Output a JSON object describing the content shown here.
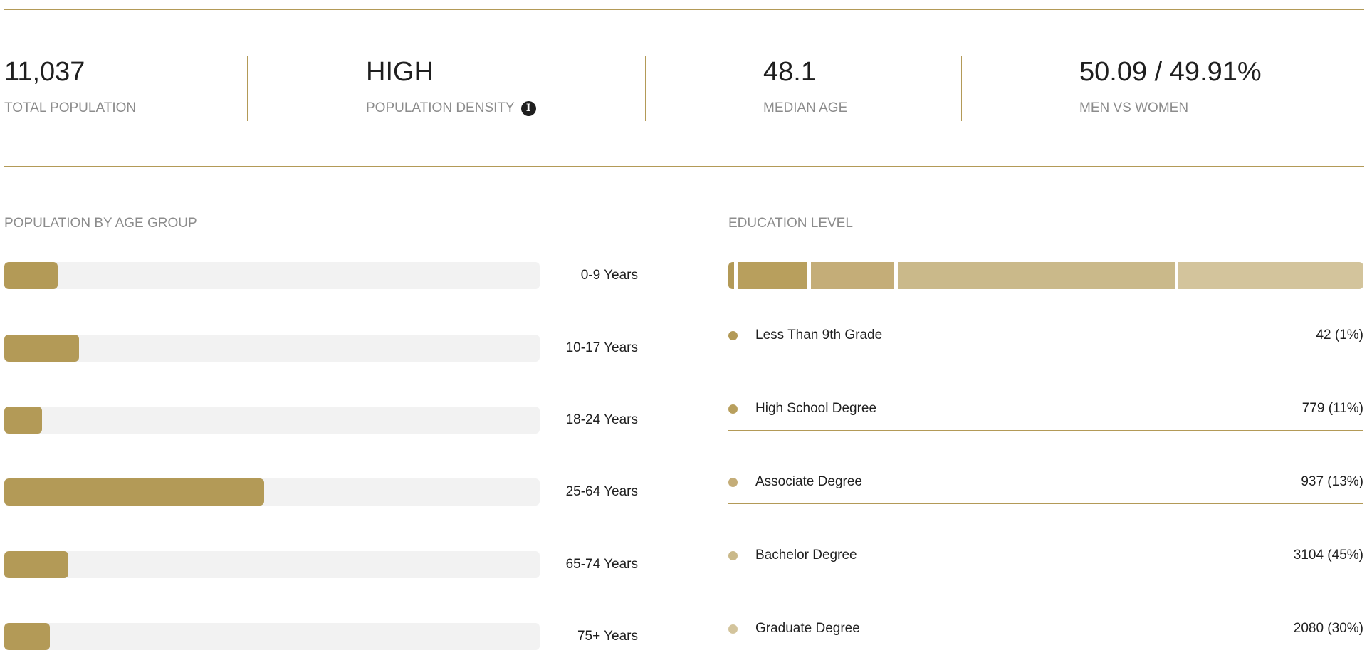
{
  "stats": [
    {
      "value": "11,037",
      "label": "TOTAL POPULATION"
    },
    {
      "value": "HIGH",
      "label": "POPULATION DENSITY",
      "icon": "info-icon"
    },
    {
      "value": "48.1",
      "label": "MEDIAN AGE"
    },
    {
      "value": "50.09 / 49.91%",
      "label": "MEN VS WOMEN"
    }
  ],
  "age_section": {
    "title": "POPULATION BY AGE GROUP",
    "groups": [
      {
        "label": "0-9 Years",
        "fraction": 0.1
      },
      {
        "label": "10-17 Years",
        "fraction": 0.14
      },
      {
        "label": "18-24 Years",
        "fraction": 0.07
      },
      {
        "label": "25-64 Years",
        "fraction": 0.485
      },
      {
        "label": "65-74 Years",
        "fraction": 0.12
      },
      {
        "label": "75+ Years",
        "fraction": 0.085
      }
    ]
  },
  "education_section": {
    "title": "EDUCATION LEVEL",
    "items": [
      {
        "label": "Less Than 9th Grade",
        "value": "42 (1%)",
        "count": 42,
        "color": "#b39a57"
      },
      {
        "label": "High School Degree",
        "value": "779 (11%)",
        "count": 779,
        "color": "#b89f5d"
      },
      {
        "label": "Associate Degree",
        "value": "937 (13%)",
        "count": 937,
        "color": "#c4ad78"
      },
      {
        "label": "Bachelor Degree",
        "value": "3104 (45%)",
        "count": 3104,
        "color": "#cab98a"
      },
      {
        "label": "Graduate Degree",
        "value": "2080 (30%)",
        "count": 2080,
        "color": "#d3c49c"
      }
    ]
  },
  "colors": {
    "accent": "#b39a57",
    "track": "#f2f2f2"
  }
}
